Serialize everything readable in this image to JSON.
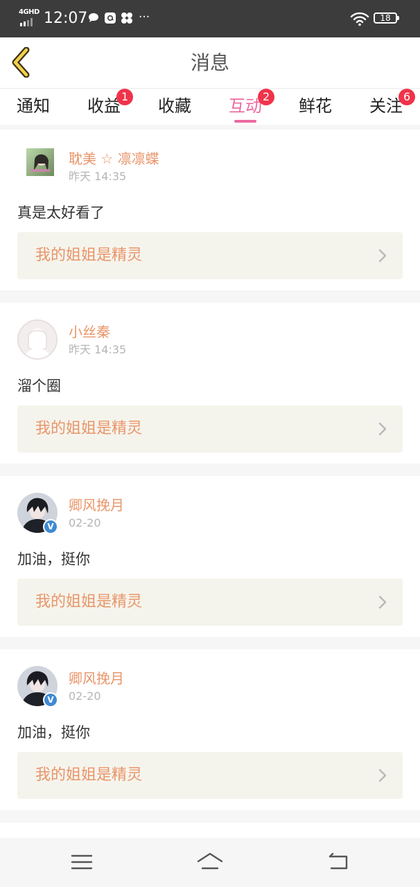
{
  "status_bar": {
    "network": "4GHD",
    "time": "12:07",
    "notification_icons": [
      "chat-bubble-icon",
      "at-sign-icon",
      "pinwheel-icon",
      "more-dots-icon"
    ],
    "battery": "18"
  },
  "header": {
    "title": "消息"
  },
  "tabs": [
    {
      "label": "通知",
      "badge": "",
      "active": false
    },
    {
      "label": "收益",
      "badge": "1",
      "active": false
    },
    {
      "label": "收藏",
      "badge": "",
      "active": false
    },
    {
      "label": "互动",
      "badge": "2",
      "active": true
    },
    {
      "label": "鲜花",
      "badge": "",
      "active": false
    },
    {
      "label": "关注",
      "badge": "6",
      "active": false
    }
  ],
  "messages": [
    {
      "user": "耽美 ☆ 凛凛蝶",
      "time": "昨天 14:35",
      "text": "真是太好看了",
      "book": "我的姐姐是精灵"
    },
    {
      "user": "小丝秦",
      "time": "昨天 14:35",
      "text": "溜个圈",
      "book": "我的姐姐是精灵"
    },
    {
      "user": "卿风挽月",
      "time": "02-20",
      "text": "加油，挺你",
      "book": "我的姐姐是精灵",
      "verified_mark": "V"
    },
    {
      "user": "卿风挽月",
      "time": "02-20",
      "text": "加油，挺你",
      "book": "我的姐姐是精灵",
      "verified_mark": "V"
    }
  ],
  "colors": {
    "accent": "#ec6aa0",
    "username": "#e9956a",
    "badge": "#f0334a",
    "book_bg": "#f5f4ec"
  }
}
